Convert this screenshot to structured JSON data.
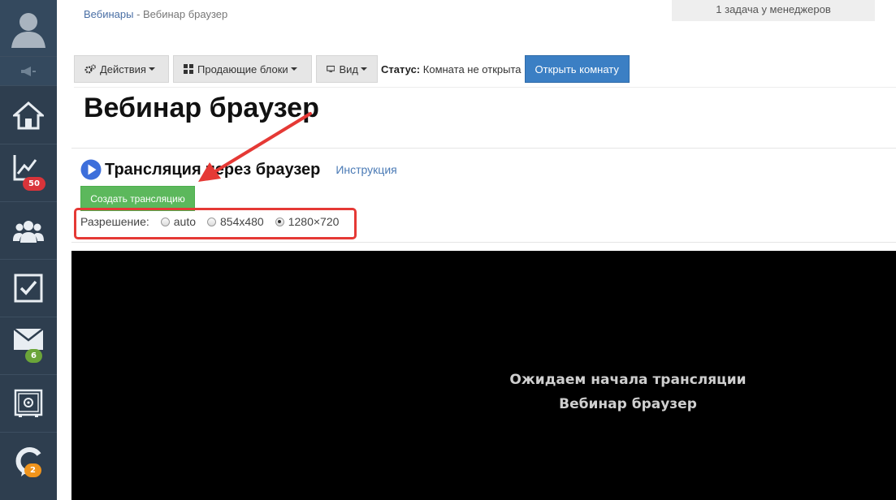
{
  "sidebar": {
    "badges": {
      "analytics": "50",
      "mail": "6",
      "messages": "2"
    }
  },
  "breadcrumb": {
    "parent": "Вебинары",
    "separator": " - ",
    "current": "Вебинар браузер"
  },
  "tasks_notice": "1 задача у менеджеров",
  "toolbar": {
    "actions_label": "Действия",
    "blocks_label": "Продающие блоки",
    "view_label": "Вид",
    "status_label": "Статус:",
    "status_value": "Комната не открыта",
    "open_room_label": "Открыть комнату"
  },
  "page_title": "Вебинар браузер",
  "broadcast": {
    "title": "Трансляция через браузер",
    "instruction_link": "Инструкция",
    "create_button": "Создать трансляцию",
    "resolution_label": "Разрешение:",
    "options": [
      "auto",
      "854x480",
      "1280×720"
    ],
    "selected": "1280×720"
  },
  "player": {
    "line1": "Ожидаем начала трансляции",
    "line2": "Вебинар браузер"
  },
  "colors": {
    "sidebar_bg": "#2e3e4f",
    "primary_button": "#3b7fc4",
    "success_button": "#5cb85c",
    "annotation": "#e53935"
  }
}
